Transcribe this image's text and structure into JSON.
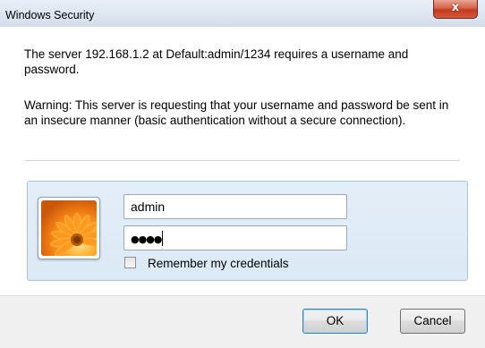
{
  "window": {
    "title": "Windows Security",
    "close_glyph": "x"
  },
  "message": {
    "line1": "The server 192.168.1.2 at Default:admin/1234 requires a username and password.",
    "warning": "Warning: This server is requesting that your username and password be sent in an insecure manner (basic authentication without a secure connection)."
  },
  "credentials": {
    "avatar_icon": "user-tile-flower-icon",
    "username_value": "admin",
    "password_mask": "●●●●",
    "remember_label": "Remember my credentials",
    "remember_checked": false
  },
  "buttons": {
    "ok_label": "OK",
    "cancel_label": "Cancel"
  },
  "colors": {
    "panel_border": "#a6c5e3",
    "close_button": "#c43a1f",
    "default_button_border": "#3c7fb1"
  }
}
